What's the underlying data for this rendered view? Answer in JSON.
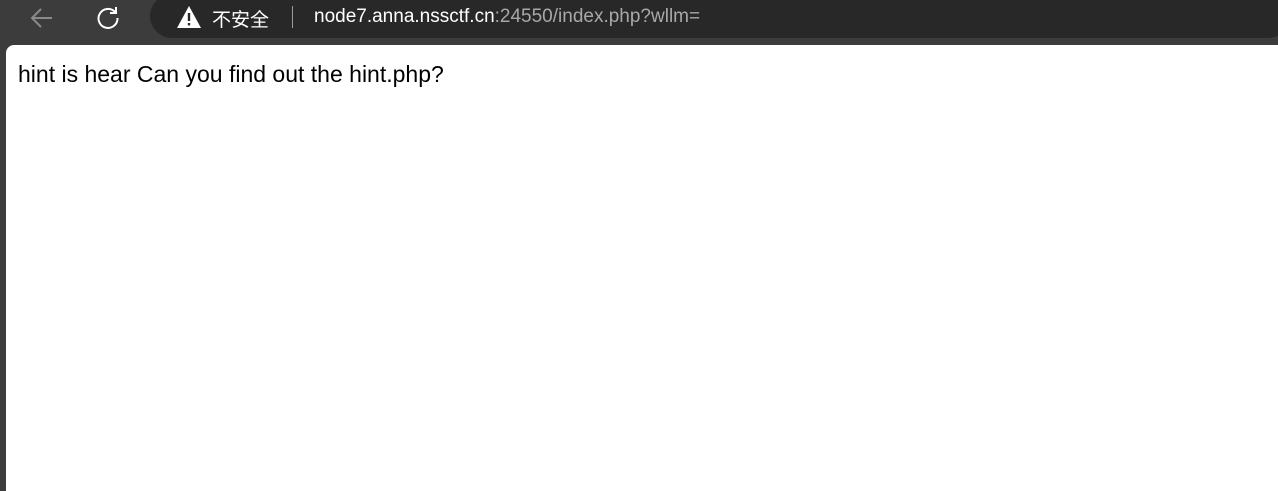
{
  "toolbar": {
    "back_icon": "arrow-left-icon",
    "reload_icon": "reload-icon",
    "security_icon": "warning-triangle-icon",
    "security_label": "不安全",
    "url_host": "node7.anna.nssctf.cn",
    "url_rest": ":24550/index.php?wllm="
  },
  "page": {
    "text": "hint is hear Can you find out the hint.php?"
  }
}
